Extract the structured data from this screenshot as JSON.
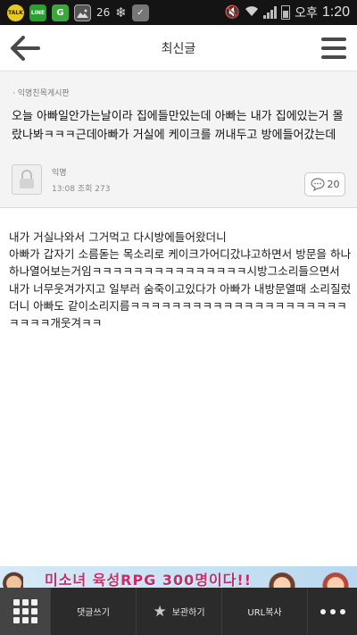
{
  "status_bar": {
    "icons": [
      "kakaotalk-icon",
      "line-icon",
      "g-app-icon",
      "gallery-icon",
      "snowflake-icon",
      "check-icon",
      "mute-icon",
      "wifi-icon",
      "signal-icon",
      "battery-icon"
    ],
    "talk_label": "TALK",
    "line_label": "LINE",
    "g_label": "G",
    "badge_count": "26",
    "am_pm": "오후",
    "time": "1:20"
  },
  "header": {
    "title": "최신글"
  },
  "post": {
    "board": "익명친목게시판",
    "title": "오늘 아빠일안가는날이라 집에들만있는데 아빠는 내가 집에있는거 몰랐나봐ㅋㅋㅋ근데아빠가 거실에 케이크를 꺼내두고 방에들어갔는데",
    "author": "익명",
    "time": "13:08",
    "views_label": "조회",
    "views": "273",
    "comment_count": "20",
    "body": "내가 거실나와서 그거먹고 다시방에들어왔더니\n아빠가 갑자기 소름돋는 목소리로 케이크가어디갔냐고하면서 방문을 하나하나열어보는거임ㅋㅋㅋㅋㅋㅋㅋㅋㅋㅋㅋㅋㅋㅋㅋ시방그소리들으면서 내가 너무웃겨가지고 일부러 숨죽이고있다가 아빠가 내방문열때 소리질렀더니 아빠도 같이소리지름ㅋㅋㅋㅋㅋㅋㅋㅋㅋㅋㅋㅋㅋㅋㅋㅋㅋㅋㅋㅋㅋㅋㅋㅋㅋ개웃겨ㅋㅋ"
  },
  "ad": {
    "text": "미소녀 육성RPG 300명이다!!"
  },
  "bottom_bar": {
    "comment_label": "댓글쓰기",
    "save_label": "보관하기",
    "copy_url_label": "URL복사"
  }
}
